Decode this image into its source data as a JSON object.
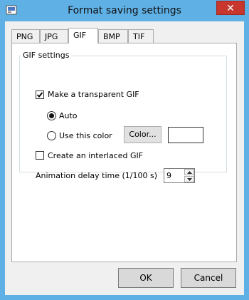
{
  "window": {
    "title": "Format saving settings",
    "close_label": "✕"
  },
  "tabs": [
    {
      "label": "PNG"
    },
    {
      "label": "JPG"
    },
    {
      "label": "GIF"
    },
    {
      "label": "BMP"
    },
    {
      "label": "TIF"
    }
  ],
  "active_tab": "GIF",
  "gif_settings": {
    "group_label": "GIF settings",
    "transparent": {
      "label": "Make a transparent GIF",
      "checked": true
    },
    "auto": {
      "label": "Auto",
      "selected": true
    },
    "use_color": {
      "label": "Use this color",
      "selected": false
    },
    "color_button_label": "Color...",
    "swatch_color": "#ffffff",
    "interlaced": {
      "label": "Create an interlaced GIF",
      "checked": false
    },
    "delay": {
      "label": "Animation delay time (1/100 s)",
      "value": "9"
    }
  },
  "buttons": {
    "ok": "OK",
    "cancel": "Cancel"
  },
  "colors": {
    "window_frame": "#5fb0e5",
    "close_button": "#c7372e"
  },
  "icons": {
    "app": "app-icon",
    "close": "close-icon"
  }
}
